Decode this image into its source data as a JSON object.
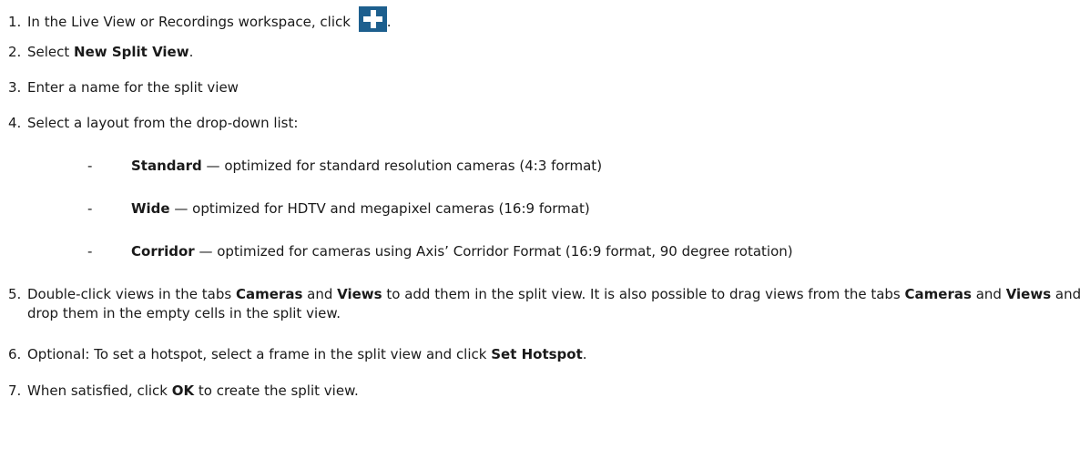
{
  "steps": [
    {
      "num": "1.",
      "pre": "In the Live View or Recordings workspace, click",
      "post": "."
    },
    {
      "num": "2.",
      "pre": "Select ",
      "bold": "New Split View",
      "post": "."
    },
    {
      "num": "3.",
      "text": "Enter a name for the split view"
    },
    {
      "num": "4.",
      "text": "Select a layout from the drop-down list:"
    },
    {
      "num": "5.",
      "a": "Double-click views in the tabs ",
      "b1": "Cameras",
      "c": " and ",
      "b2": "Views",
      "d": " to add them in the split view. It is also possible to drag views from the tabs ",
      "b3": "Cameras",
      "e": " and ",
      "b4": "Views",
      "f": " and drop them in the empty cells in the split view."
    },
    {
      "num": "6.",
      "pre": "Optional: To set a hotspot, select a frame in the split view and click ",
      "bold": "Set Hotspot",
      "post": "."
    },
    {
      "num": "7.",
      "pre": "When satisfied, click ",
      "bold": "OK",
      "post": " to create the split view."
    }
  ],
  "layouts": [
    {
      "dash": "-",
      "name": "Standard",
      "desc": " — optimized for standard resolution cameras (4:3 format)"
    },
    {
      "dash": "-",
      "name": "Wide",
      "desc": " — optimized for HDTV and megapixel cameras (16:9 format)"
    },
    {
      "dash": "-",
      "name": "Corridor",
      "desc": " — optimized for cameras using Axis’ Corridor Format (16:9 format, 90 degree rotation)"
    }
  ],
  "icons": {
    "add": "plus-icon",
    "add_color": "#1d5f8e"
  }
}
